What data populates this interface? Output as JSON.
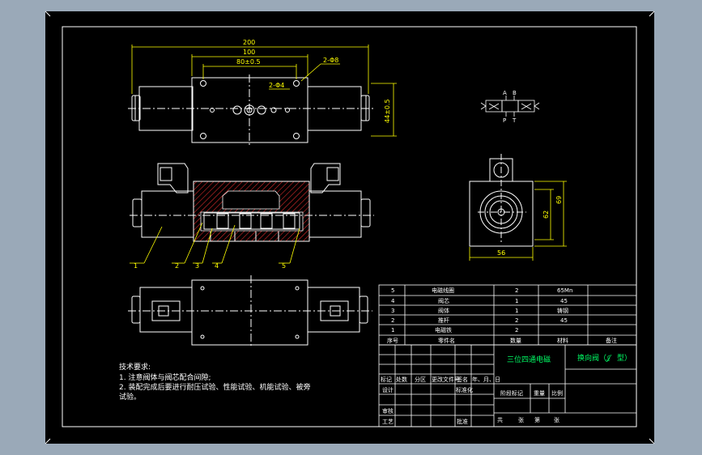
{
  "dims": {
    "overall": "200",
    "body": "100",
    "holes": "80±0.5",
    "pin_holes": "2-Φ8",
    "bolt_holes": "2-Φ4",
    "height": "44±0.5",
    "side_width": "56",
    "side_height_outer": "69",
    "side_height_inner": "62"
  },
  "symbol": {
    "a": "A",
    "b": "B",
    "p": "P",
    "t": "T"
  },
  "balloons": [
    "1",
    "2",
    "3",
    "4",
    "5"
  ],
  "notes": {
    "title": "技术要求:",
    "line1": "1. 注意阀体与阀芯配合间隙;",
    "line2": "2. 装配完成后要进行耐压试验、性能试验、机能试验、被旁",
    "line3": "试验。"
  },
  "bom": {
    "rows": [
      {
        "no": "5",
        "name": "电磁线圈",
        "qty": "2",
        "material": "65Mn",
        "note": ""
      },
      {
        "no": "4",
        "name": "阀芯",
        "qty": "1",
        "material": "45",
        "note": ""
      },
      {
        "no": "3",
        "name": "阀体",
        "qty": "1",
        "material": "铸钢",
        "note": ""
      },
      {
        "no": "2",
        "name": "推杆",
        "qty": "2",
        "material": "45",
        "note": ""
      },
      {
        "no": "1",
        "name": "电磁铁",
        "qty": "2",
        "material": "",
        "note": ""
      }
    ],
    "header": {
      "no": "序号",
      "name": "零件名",
      "qty": "数量",
      "material": "材料",
      "note": "备注"
    }
  },
  "title_block": {
    "design_name": "三位四通电磁",
    "drawing_name": "换向阀（",
    "drawing_name_tail": "型）",
    "labels": {
      "mark": "标记",
      "count": "处数",
      "zone": "分区",
      "change_doc": "更改文件号",
      "sign": "签名",
      "date": "年、月、日",
      "design": "设计",
      "standard": "标准化",
      "stage_mark": "阶段标记",
      "weight": "重量",
      "scale": "比例",
      "review": "审核",
      "craft": "工艺",
      "approve": "批准",
      "total": "共",
      "sheets": "张",
      "sheet_no": "第",
      "sheet_word": "张"
    }
  },
  "colors": {
    "background": "#9aa9b8",
    "sheet": "#000000",
    "line": "#ffffff",
    "dimension": "#ffff00",
    "hatch": "#ff3333",
    "accent_green": "#00ff66"
  }
}
